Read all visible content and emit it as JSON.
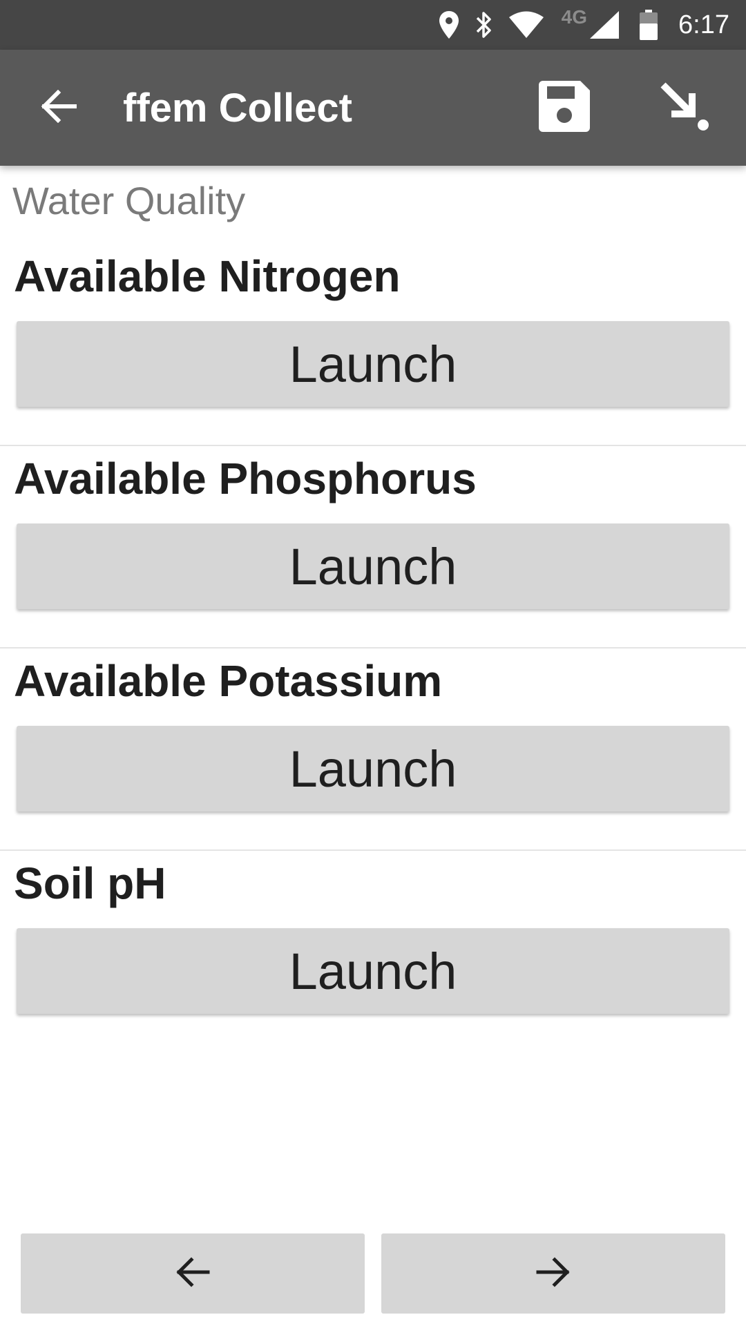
{
  "status_bar": {
    "time": "6:17",
    "network_label": "4G",
    "icons": [
      "location-icon",
      "bluetooth-icon",
      "wifi-icon",
      "cell-signal-icon",
      "battery-icon"
    ]
  },
  "app_bar": {
    "title": "ffem Collect",
    "back_icon": "arrow-left-icon",
    "actions": [
      "save-icon",
      "jump-to-icon"
    ]
  },
  "form": {
    "group_label": "Water Quality",
    "questions": [
      {
        "label": "Available Nitrogen",
        "button": "Launch"
      },
      {
        "label": "Available Phosphorus",
        "button": "Launch"
      },
      {
        "label": "Available Potassium",
        "button": "Launch"
      },
      {
        "label": "Soil pH",
        "button": "Launch"
      }
    ]
  },
  "navigation": {
    "prev_icon": "arrow-left-icon",
    "next_icon": "arrow-right-icon"
  },
  "colors": {
    "status_bar": "#464646",
    "app_bar": "#595959",
    "button_bg": "#d6d6d6",
    "group_label": "#7a7a7a",
    "text": "#1f1f1f"
  }
}
